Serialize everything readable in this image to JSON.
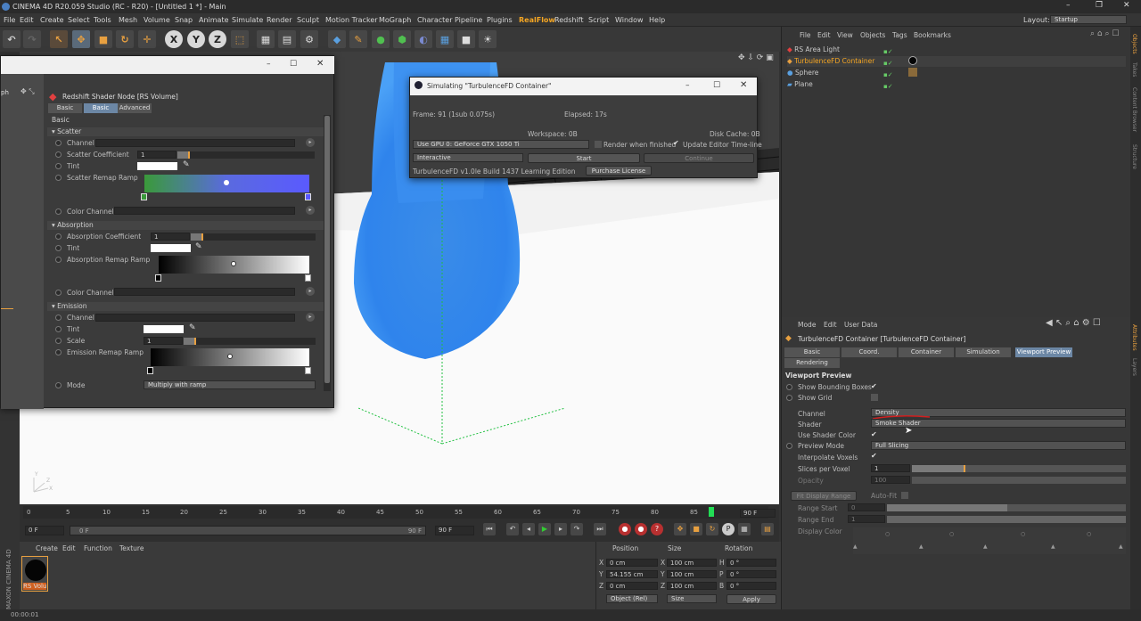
{
  "window": {
    "title": "CINEMA 4D R20.059 Studio (RC - R20) - [Untitled 1 *] - Main",
    "minimize": "–",
    "maximize": "❐",
    "close": "✕"
  },
  "menu": [
    "File",
    "Edit",
    "Create",
    "Select",
    "Tools",
    "Mesh",
    "Volume",
    "Snap",
    "Animate",
    "Simulate",
    "Render",
    "Sculpt",
    "Motion Tracker",
    "MoGraph",
    "Character",
    "Pipeline",
    "Plugins",
    "RealFlow",
    "Redshift",
    "Script",
    "Window",
    "Help"
  ],
  "layout": {
    "label": "Layout:",
    "value": "Startup"
  },
  "toolbar": {
    "x_axis": "X",
    "y_axis": "Y",
    "z_axis": "Z"
  },
  "viewport": {
    "axis_y": "Y",
    "axis_z": "Z",
    "axis_x": "X"
  },
  "shader_window": {
    "title": "Redshift Shader Node [RS Volume]",
    "panel_title": "ph",
    "tabs": [
      "Basic",
      "Basic",
      "Advanced"
    ],
    "basic_header": "Basic",
    "scatter": {
      "header": "Scatter",
      "channel": "Channel",
      "coef_label": "Scatter Coefficient",
      "coef_value": "1",
      "tint": "Tint",
      "ramp": "Scatter Remap Ramp",
      "color_channel": "Color Channel"
    },
    "absorption": {
      "header": "Absorption",
      "coef_label": "Absorption Coefficient",
      "coef_value": "1",
      "tint": "Tint",
      "ramp": "Absorption Remap Ramp",
      "color_channel": "Color Channel"
    },
    "emission": {
      "header": "Emission",
      "channel": "Channel",
      "tint": "Tint",
      "scale_label": "Scale",
      "scale_value": "1",
      "ramp": "Emission Remap Ramp"
    },
    "mode": {
      "label": "Mode",
      "value": "Multiply with ramp"
    }
  },
  "sim_window": {
    "title": "Simulating \"TurbulenceFD Container\"",
    "frame": "Frame: 91 (1sub 0.075s)",
    "elapsed": "Elapsed: 17s",
    "workspace": "Workspace: 0B",
    "disk_cache": "Disk Cache: 0B",
    "gpu": "Use GPU 0: GeForce GTX 1050 Ti",
    "render_when_finished": "Render when finished",
    "update_editor": "Update Editor Time-line",
    "mode": "Interactive",
    "start": "Start",
    "continue": "Continue",
    "build": "TurbulenceFD v1.0le Build 1437 Learning Edition",
    "purchase": "Purchase License"
  },
  "object_manager": {
    "menu": [
      "File",
      "Edit",
      "View",
      "Objects",
      "Tags",
      "Bookmarks"
    ],
    "objects": [
      "RS Area Light",
      "TurbulenceFD Container",
      "Sphere",
      "Plane"
    ]
  },
  "attributes": {
    "menu": [
      "Mode",
      "Edit",
      "User Data"
    ],
    "object_title": "TurbulenceFD Container [TurbulenceFD Container]",
    "tabs": [
      "Basic",
      "Coord.",
      "Container",
      "Simulation",
      "Viewport Preview",
      "Rendering"
    ],
    "section": "Viewport Preview",
    "rows": {
      "show_bounding": "Show Bounding Boxes",
      "show_grid": "Show Grid",
      "channel_label": "Channel",
      "channel_value": "Density",
      "shader_label": "Shader",
      "shader_value": "Smoke Shader",
      "use_shader_color": "Use Shader Color",
      "preview_mode_label": "Preview Mode",
      "preview_mode_value": "Full Slicing",
      "interpolate": "Interpolate Voxels",
      "slices_label": "Slices per Voxel",
      "slices_value": "1",
      "opacity_label": "Opacity",
      "opacity_value": "100",
      "fit_display": "Fit Display Range",
      "auto_fit": "Auto-Fit",
      "range_start": "Range Start",
      "range_start_value": "0",
      "range_end": "Range End",
      "range_end_value": "1",
      "display_color": "Display Color"
    }
  },
  "timeline": {
    "ticks": [
      "0",
      "5",
      "10",
      "15",
      "20",
      "25",
      "30",
      "35",
      "40",
      "45",
      "50",
      "55",
      "60",
      "65",
      "70",
      "75",
      "80",
      "85",
      "90"
    ],
    "current_frame": "90 F",
    "start_field": "0 F",
    "range_start": "0 F",
    "range_end": "90 F",
    "end_field": "90 F",
    "play_position": 0.92
  },
  "material_manager": {
    "menu": [
      "Create",
      "Edit",
      "Function",
      "Texture"
    ],
    "material_name": "RS Volu",
    "brand": "MAXON CINEMA 4D"
  },
  "coords": {
    "headers": [
      "Position",
      "Size",
      "Rotation"
    ],
    "rows": [
      {
        "axis": "X",
        "pos": "0 cm",
        "size_axis": "X",
        "size": "100 cm",
        "rot_axis": "H",
        "rot": "0 °"
      },
      {
        "axis": "Y",
        "pos": "54.155 cm",
        "size_axis": "Y",
        "size": "100 cm",
        "rot_axis": "P",
        "rot": "0 °"
      },
      {
        "axis": "Z",
        "pos": "0 cm",
        "size_axis": "Z",
        "size": "100 cm",
        "rot_axis": "B",
        "rot": "0 °"
      }
    ],
    "mode": "Object (Rel)",
    "size_mode": "Size",
    "apply": "Apply"
  },
  "status": {
    "time": "00:00:01"
  },
  "right_tabs": [
    "Objects",
    "Takes",
    "Content Browser",
    "Structure",
    "Attributes",
    "Layers"
  ]
}
